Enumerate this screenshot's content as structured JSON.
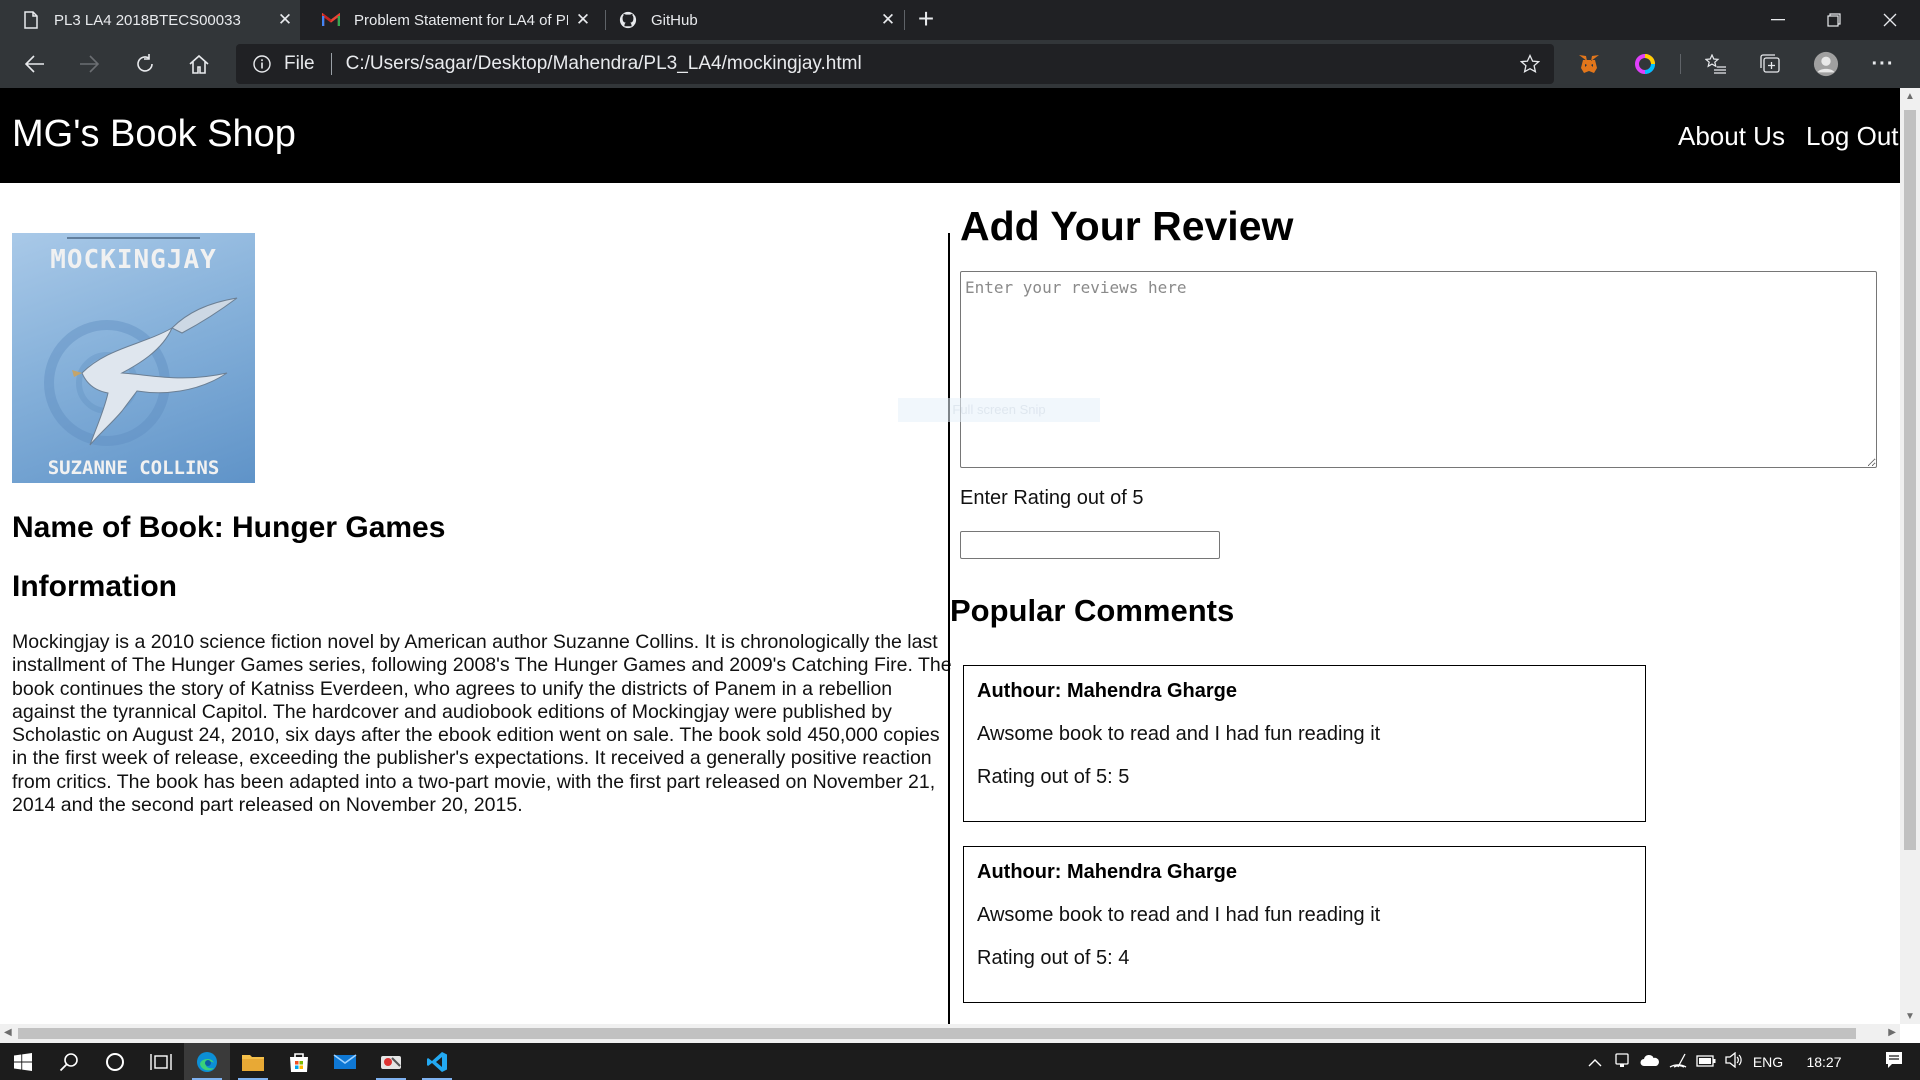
{
  "browser": {
    "tabs": [
      {
        "title": "PL3 LA4 2018BTECS00033",
        "icon": "page-icon",
        "active": true
      },
      {
        "title": "Problem Statement for LA4 of PL3",
        "icon": "gmail-icon",
        "active": false
      },
      {
        "title": "GitHub",
        "icon": "github-icon",
        "active": false
      }
    ],
    "address": {
      "scheme_label": "File",
      "url": "C:/Users/sagar/Desktop/Mahendra/PL3_LA4/mockingjay.html"
    }
  },
  "site": {
    "brand": "MG's Book Shop",
    "nav": [
      "About Us",
      "Log Out"
    ]
  },
  "book": {
    "cover": {
      "title": "MOCKINGJAY",
      "author": "SUZANNE COLLINS"
    },
    "name_heading": "Name of Book: Hunger Games",
    "info_heading": "Information",
    "info_text": "Mockingjay is a 2010 science fiction novel by American author Suzanne Collins. It is chronologically the last installment of The Hunger Games series, following 2008's The Hunger Games and 2009's Catching Fire. The book continues the story of Katniss Everdeen, who agrees to unify the districts of Panem in a rebellion against the tyrannical Capitol. The hardcover and audiobook editions of Mockingjay were published by Scholastic on August 24, 2010, six days after the ebook edition went on sale. The book sold 450,000 copies in the first week of release, exceeding the publisher's expectations. It received a generally positive reaction from critics. The book has been adapted into a two-part movie, with the first part released on November 21, 2014 and the second part released on November 20, 2015."
  },
  "review": {
    "heading": "Add Your Review",
    "placeholder": "Enter your reviews here",
    "rating_label": "Enter Rating out of 5",
    "rating_value": ""
  },
  "comments": {
    "heading": "Popular Comments",
    "items": [
      {
        "author": "Authour: Mahendra Gharge",
        "text": "Awsome book to read and I had fun reading it",
        "rating": "Rating out of 5: 5"
      },
      {
        "author": "Authour: Mahendra Gharge",
        "text": "Awsome book to read and I had fun reading it",
        "rating": "Rating out of 5: 4"
      }
    ]
  },
  "overlay": {
    "snip_label": "Full screen Snip"
  },
  "taskbar": {
    "language": "ENG",
    "time": "18:27"
  }
}
